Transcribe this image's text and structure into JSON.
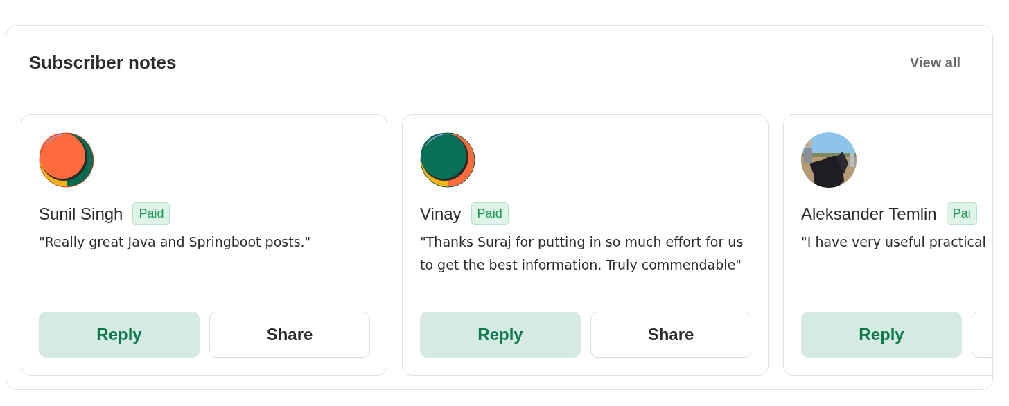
{
  "header": {
    "title": "Subscriber notes",
    "link": "View all"
  },
  "notes": [
    {
      "avatar": {
        "kind": "orange"
      },
      "name": "Sunil Singh",
      "badge": "Paid",
      "quote": "\"Really great Java and Springboot posts.\"",
      "buttons": [
        {
          "kind": "reply",
          "label": "Reply"
        },
        {
          "kind": "share",
          "label": "Share"
        }
      ]
    },
    {
      "avatar": {
        "kind": "green"
      },
      "name": "Vinay",
      "badge": "Paid",
      "quote": "\"Thanks Suraj for putting in so much effort for us to get the best information. Truly commendable\"",
      "buttons": [
        {
          "kind": "reply",
          "label": "Reply"
        },
        {
          "kind": "share",
          "label": "Share"
        }
      ]
    },
    {
      "avatar": {
        "kind": "picture"
      },
      "name": "Aleksander Temlin",
      "badge": "Pai",
      "quote": "\"I have very useful practical",
      "buttons": [
        {
          "kind": "reply",
          "label": "Reply"
        },
        {
          "kind": "share"
        }
      ]
    }
  ]
}
